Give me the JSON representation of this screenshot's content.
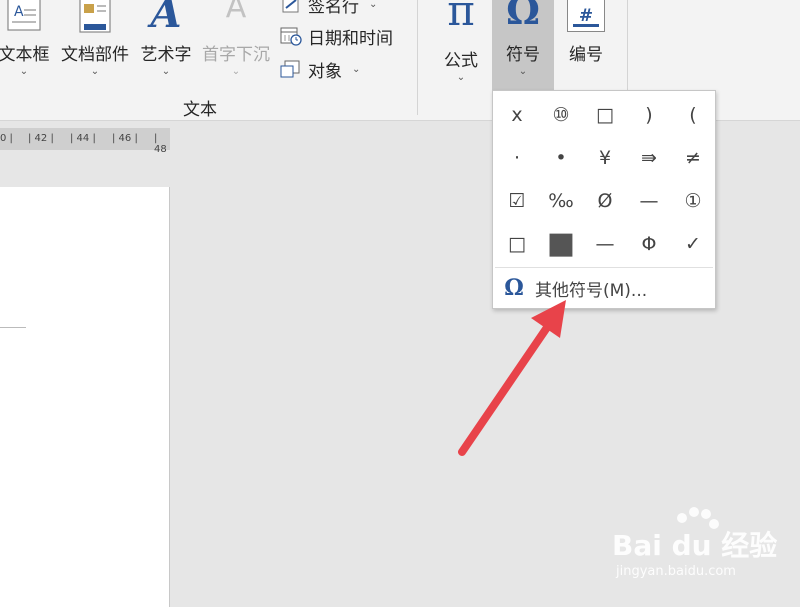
{
  "ribbon": {
    "buttons": {
      "text_box": {
        "label": "文本框",
        "arrow": "⌄"
      },
      "quick_parts": {
        "label": "文档部件",
        "arrow": "⌄"
      },
      "wordart": {
        "label": "艺术字",
        "arrow": "⌄"
      },
      "drop_cap": {
        "label": "首字下沉",
        "arrow": "⌄"
      },
      "equation": {
        "label": "公式",
        "arrow": "⌄"
      },
      "symbol": {
        "label": "符号",
        "arrow": "⌄"
      },
      "number": {
        "label": "编号"
      }
    },
    "small_buttons": {
      "signature_line": {
        "label": "签名行",
        "arrow": "⌄"
      },
      "date_time": {
        "label": "日期和时间"
      },
      "object": {
        "label": "对象",
        "arrow": "⌄"
      }
    },
    "group_label": "文本",
    "icon_glyphs": {
      "wordart": "A",
      "equation": "π",
      "symbol": "Ω",
      "number": "#",
      "drop_cap": "A"
    }
  },
  "ruler": {
    "ticks": [
      "0 |",
      "| 42 |",
      "| 44 |",
      "| 46 |",
      "| 48"
    ]
  },
  "symbol_panel": {
    "symbols": [
      "x",
      "⑩",
      "□",
      ")",
      "(",
      "·",
      "•",
      "¥",
      "⇛",
      "≠",
      "☑",
      "‰",
      "Ø",
      "—",
      "①",
      "□",
      "■",
      "—",
      "Φ",
      "✓"
    ],
    "more_icon": "Ω",
    "more_label": "其他符号(M)..."
  },
  "watermark": {
    "main": "Bai du 经验",
    "sub": "jingyan.baidu.com"
  },
  "colors": {
    "accent": "#2b579a",
    "arrow": "#e8434a",
    "selected_button": "#c6c6c6"
  }
}
